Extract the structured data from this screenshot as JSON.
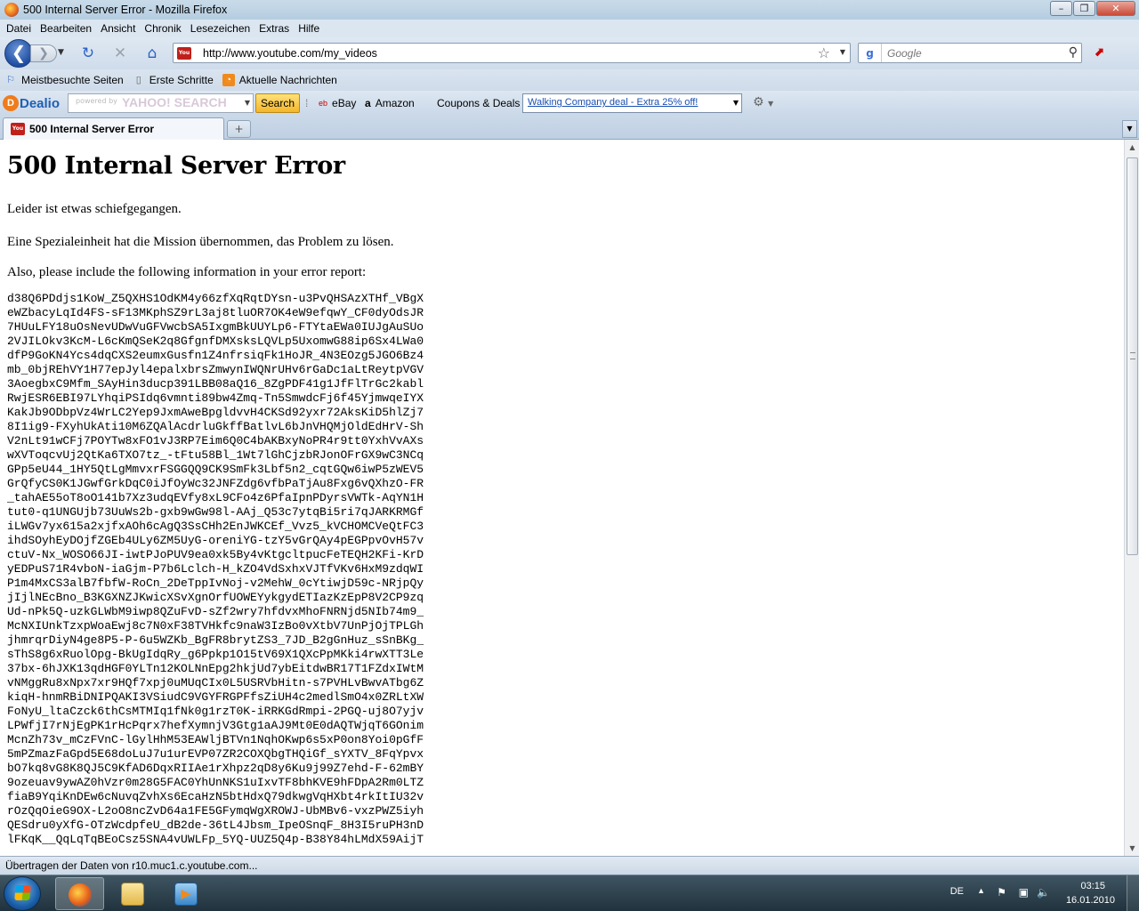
{
  "window": {
    "title": "500 Internal Server Error - Mozilla Firefox",
    "minimize": "–",
    "maximize": "❐",
    "close": "✕"
  },
  "menu": [
    "Datei",
    "Bearbeiten",
    "Ansicht",
    "Chronik",
    "Lesezeichen",
    "Extras",
    "Hilfe"
  ],
  "nav": {
    "url": "http://www.youtube.com/my_videos",
    "search_placeholder": "Google",
    "back_glyph": "❮",
    "forward_glyph": "❯",
    "reload_glyph": "↻",
    "stop_glyph": "✕",
    "home_glyph": "⌂"
  },
  "bookmarks": [
    {
      "label": "Meistbesuchte Seiten",
      "icon": "bookmark-star-icon"
    },
    {
      "label": "Erste Schritte",
      "icon": "page-icon"
    },
    {
      "label": "Aktuelle Nachrichten",
      "icon": "rss-icon"
    }
  ],
  "dealio": {
    "brand": "Dealio",
    "powered_by": "powered by",
    "search_brand": "YAHOO! SEARCH",
    "search_button": "Search",
    "ebay": "eBay",
    "amazon": "Amazon",
    "coupons": "Coupons & Deals",
    "deal_link": "Walking Company deal - Extra 25% off!"
  },
  "tab": {
    "label": "500 Internal Server Error",
    "new_tab": "+"
  },
  "page": {
    "heading": "500 Internal Server Error",
    "para1": "Leider ist etwas schiefgegangen.",
    "para2": "Eine Spezialeinheit hat die Mission übernommen, das Problem zu lösen.",
    "para3": "Also, please include the following information in your error report:",
    "error_lines": [
      "d38Q6PDdjs1KoW_Z5QXHS1OdKM4y66zfXqRqtDYsn-u3PvQHSAzXTHf_VBgX",
      "eWZbacyLqId4FS-sF13MKphSZ9rL3aj8tluOR7OK4eW9efqwY_CF0dyOdsJR",
      "7HUuLFY18uOsNevUDwVuGFVwcbSA5IxgmBkUUYLp6-FTYtaEWa0IUJgAuSUo",
      "2VJILOkv3KcM-L6cKmQSeK2q8GfgnfDMXsksLQVLp5UxomwG88ip6Sx4LWa0",
      "dfP9GoKN4Ycs4dqCXS2eumxGusfn1Z4nfrsiqFk1HoJR_4N3EOzg5JGO6Bz4",
      "mb_0bjREhVY1H77epJyl4epalxbrsZmwynIWQNrUHv6rGaDc1aLtReytpVGV",
      "3AoegbxC9Mfm_SAyHin3ducp391LBB08aQ16_8ZgPDF41g1JfFlTrGc2kabl",
      "RwjESR6EBI97LYhqiPSIdq6vmnti89bw4Zmq-Tn5SmwdcFj6f45YjmwqeIYX",
      "KakJb9ODbpVz4WrLC2Yep9JxmAweBpgldvvH4CKSd92yxr72AksKiD5hlZj7",
      "8I1ig9-FXyhUkAti10M6ZQAlAcdrluGkffBatlvL6bJnVHQMjOldEdHrV-Sh",
      "V2nLt91wCFj7POYTw8xFO1vJ3RP7Eim6Q0C4bAKBxyNoPR4r9tt0YxhVvAXs",
      "wXVToqcvUj2QtKa6TXO7tz_-tFtu58Bl_1Wt7lGhCjzbRJonOFrGX9wC3NCq",
      "GPp5eU44_1HY5QtLgMmvxrFSGGQQ9CK9SmFk3Lbf5n2_cqtGQw6iwP5zWEV5",
      "GrQfyCS0K1JGwfGrkDqC0iJfOyWc32JNFZdg6vfbPaTjAu8Fxg6vQXhzO-FR",
      "_tahAE55oT8oO141b7Xz3udqEVfy8xL9CFo4z6PfaIpnPDyrsVWTk-AqYN1H",
      "tut0-q1UNGUjb73UuWs2b-gxb9wGw98l-AAj_Q53c7ytqBi5ri7qJARKRMGf",
      "iLWGv7yx615a2xjfxAOh6cAgQ3SsCHh2EnJWKCEf_Vvz5_kVCHOMCVeQtFC3",
      "ihdSOyhEyDOjfZGEb4ULy6ZM5UyG-oreniYG-tzY5vGrQAy4pEGPpvOvH57v",
      "ctuV-Nx_WOSO66JI-iwtPJoPUV9ea0xk5By4vKtgcltpucFeTEQH2KFi-KrD",
      "yEDPuS71R4vboN-iaGjm-P7b6Lclch-H_kZO4VdSxhxVJTfVKv6HxM9zdqWI",
      "P1m4MxCS3alB7fbfW-RoCn_2DeTppIvNoj-v2MehW_0cYtiwjD59c-NRjpQy",
      "jIjlNEcBno_B3KGXNZJKwicXSvXgnOrfUOWEYykgydETIazKzEpP8V2CP9zq",
      "Ud-nPk5Q-uzkGLWbM9iwp8QZuFvD-sZf2wry7hfdvxMhoFNRNjd5NIb74m9_",
      "McNXIUnkTzxpWoaEwj8c7N0xF38TVHkfc9naW3IzBo0vXtbV7UnPjOjTPLGh",
      "jhmrqrDiyN4ge8P5-P-6u5WZKb_BgFR8brytZS3_7JD_B2gGnHuz_sSnBKg_",
      "sThS8g6xRuolOpg-BkUgIdqRy_g6Ppkp1O15tV69X1QXcPpMKki4rwXTT3Le",
      "37bx-6hJXK13qdHGF0YLTn12KOLNnEpg2hkjUd7ybEitdwBR17T1FZdxIWtM",
      "vNMggRu8xNpx7xr9HQf7xpj0uMUqCIx0L5USRVbHitn-s7PVHLvBwvATbg6Z",
      "kiqH-hnmRBiDNIPQAKI3VSiudC9VGYFRGPFfsZiUH4c2medlSmO4x0ZRLtXW",
      "FoNyU_ltaCzck6thCsMTMIq1fNk0g1rzT0K-iRRKGdRmpi-2PGQ-uj8O7yjv",
      "LPWfjI7rNjEgPK1rHcPqrx7hefXymnjV3Gtg1aAJ9Mt0E0dAQTWjqT6GOnim",
      "McnZh73v_mCzFVnC-lGylHhM53EAWljBTVn1NqhOKwp6s5xP0on8Yoi0pGfF",
      "5mPZmazFaGpd5E68doLuJ7u1urEVP07ZR2COXQbgTHQiGf_sYXTV_8FqYpvx",
      "bO7kq8vG8K8QJ5C9KfAD6DqxRIIAe1rXhpz2qD8y6Ku9j99Z7ehd-F-62mBY",
      "9ozeuav9ywAZ0hVzr0m28G5FAC0YhUnNKS1uIxvTF8bhKVE9hFDpA2Rm0LTZ",
      "fiaB9YqiKnDEw6cNuvqZvhXs6EcaHzN5btHdxQ79dkwgVqHXbt4rkItIU32v",
      "rOzQqOieG9OX-L2oO8ncZvD64a1FE5GFymqWgXROWJ-UbMBv6-vxzPWZ5iyh",
      "QESdru0yXfG-OTzWcdpfeU_dB2de-36tL4Jbsm_IpeOSnqF_8H3I5ruPH3nD",
      "lFKqK__QqLqTqBEoCsz5SNA4vUWLFp_5YQ-UUZ5Q4p-B38Y84hLMdX59AijT"
    ]
  },
  "status": "Übertragen der Daten von r10.muc1.c.youtube.com...",
  "taskbar": {
    "language": "DE",
    "time": "03:15",
    "date": "16.01.2010"
  },
  "colors": {
    "titlebar": "#c3d7e8",
    "back_button": "#1d4da2",
    "youtube_red": "#c0201b",
    "deal_link": "#1a4fb0",
    "taskbar": "#2b3e4a"
  }
}
